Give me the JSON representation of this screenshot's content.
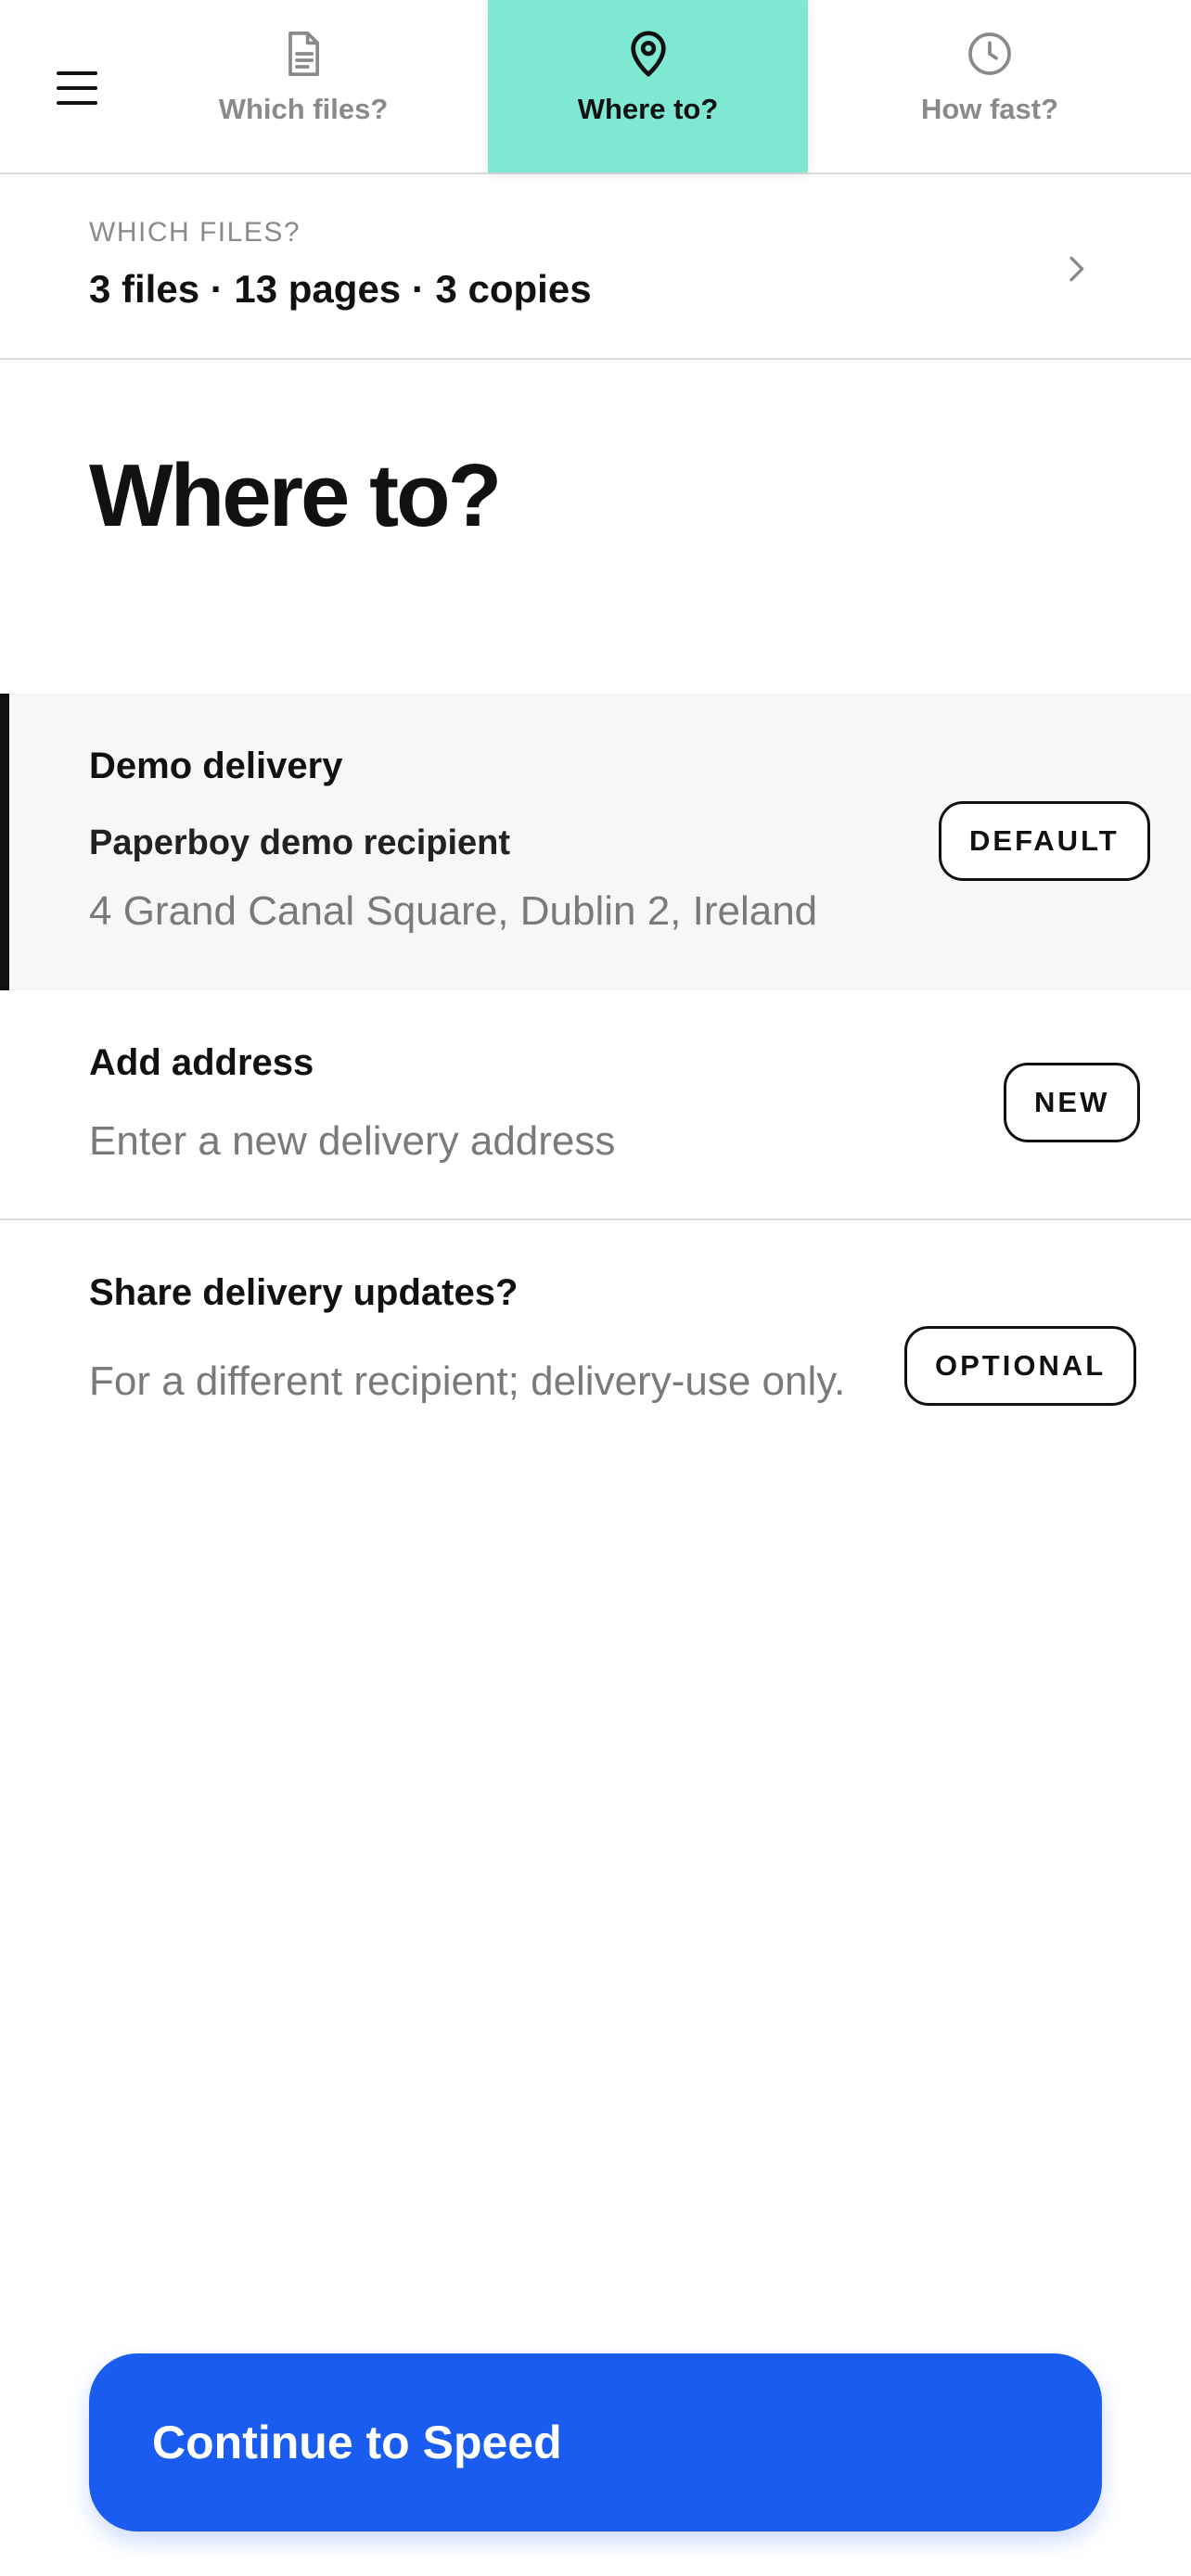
{
  "nav": {
    "menu_icon": "hamburger-menu-icon",
    "steps": [
      {
        "label": "Which files?",
        "icon": "document-icon",
        "active": false
      },
      {
        "label": "Where to?",
        "icon": "map-pin-icon",
        "active": true
      },
      {
        "label": "How fast?",
        "icon": "clock-icon",
        "active": false
      }
    ],
    "active_color": "#7ee8d3"
  },
  "summary": {
    "eyebrow": "WHICH FILES?",
    "value": "3 files · 13 pages · 3 copies",
    "icon": "chevron-right-icon"
  },
  "page": {
    "title": "Where to?"
  },
  "options": {
    "demo": {
      "title": "Demo delivery",
      "recipient": "Paperboy demo recipient",
      "address": "4 Grand Canal Square, Dublin 2, Ireland",
      "badge": "DEFAULT",
      "selected": true
    },
    "add": {
      "title": "Add address",
      "description": "Enter a new delivery address",
      "badge": "NEW"
    },
    "share": {
      "title": "Share delivery updates?",
      "description": "For a different recipient; delivery-use only.",
      "badge": "OPTIONAL"
    }
  },
  "footer": {
    "continue_label": "Continue to Speed",
    "button_color": "#1a5cf0"
  }
}
